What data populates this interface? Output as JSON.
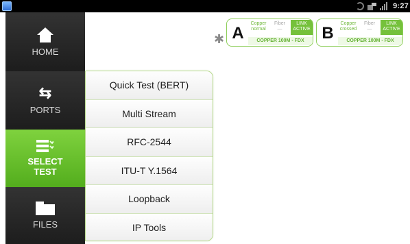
{
  "status_bar": {
    "time": "9:27",
    "icons": [
      "app-icon",
      "sync-icon",
      "screen-icon",
      "signal-icon"
    ]
  },
  "sidebar": {
    "items": [
      {
        "label": "HOME",
        "icon": "home-icon",
        "active": false
      },
      {
        "label": "PORTS",
        "icon": "ports-icon",
        "active": false
      },
      {
        "label": "SELECT\nTEST",
        "icon": "select-list-icon",
        "active": true
      },
      {
        "label": "FILES",
        "icon": "folder-icon",
        "active": false
      }
    ]
  },
  "test_menu": {
    "items": [
      "Quick Test (BERT)",
      "Multi Stream",
      "RFC-2544",
      "ITU-T Y.1564",
      "Loopback",
      "IP Tools"
    ]
  },
  "port_status": {
    "bluetooth_icon": "bluetooth-icon",
    "ports": [
      {
        "letter": "A",
        "copper_label": "Copper",
        "copper_mode": "normal",
        "fiber_label": "Fiber",
        "fiber_value": "—",
        "link_label": "LINK",
        "link_state": "ACTIVE",
        "summary": "COPPER 100M  - FDX"
      },
      {
        "letter": "B",
        "copper_label": "Copper",
        "copper_mode": "crossed",
        "fiber_label": "Fiber",
        "fiber_value": "—",
        "link_label": "LINK",
        "link_state": "ACTIVE",
        "summary": "COPPER 100M  - FDX"
      }
    ]
  },
  "colors": {
    "accent_green": "#6cbf2e",
    "sidebar_dark": "#262626",
    "statusbar_bg": "#000000"
  }
}
